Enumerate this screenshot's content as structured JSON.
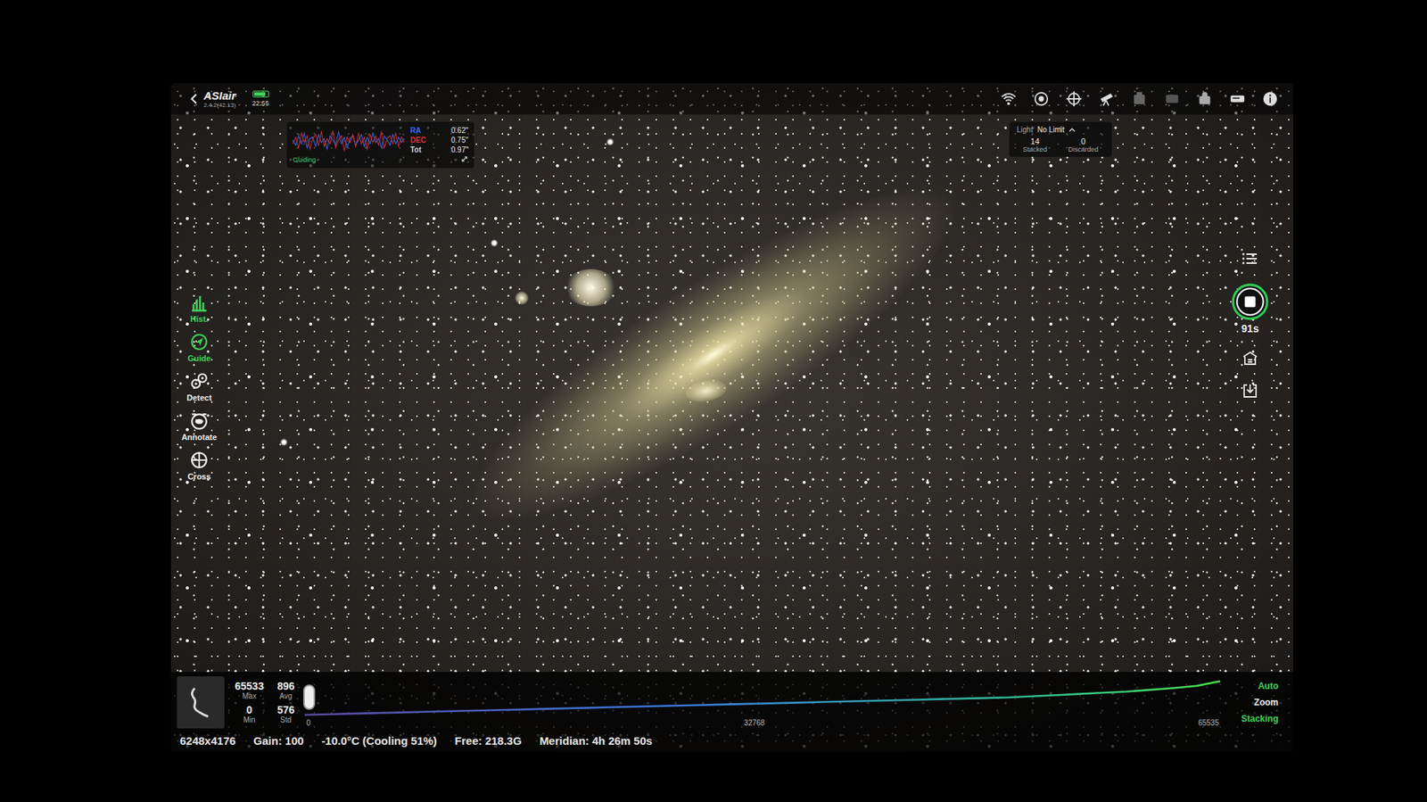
{
  "top_bar": {
    "app": "ASIair",
    "version": "2.4.2(42.13)",
    "time": "22:55",
    "battery_level": 0.85
  },
  "guiding": {
    "label": "Guiding",
    "readings": [
      {
        "name": "RA",
        "value": "0.62\"",
        "color": "#3a6cff"
      },
      {
        "name": "DEC",
        "value": "0.75\"",
        "color": "#e03030"
      },
      {
        "name": "Tot",
        "value": "0.97\"",
        "color": "#d8d8d8"
      }
    ],
    "ra_series": [
      0.1,
      -0.3,
      0.4,
      -0.2,
      0.6,
      -0.5,
      0.2,
      0.3,
      -0.4,
      0.5,
      -0.1,
      0.2,
      -0.6,
      0.4,
      0.1,
      -0.3,
      0.7,
      -0.2,
      0.3,
      -0.5,
      0.2,
      0.4,
      -0.3,
      0.1,
      0.5,
      -0.4,
      0.3,
      -0.2,
      0.6,
      -0.1,
      0.2,
      -0.5,
      0.4,
      0.1,
      -0.3,
      0.5,
      -0.2,
      0.3,
      -0.1,
      0.2
    ],
    "dec_series": [
      -0.2,
      0.3,
      -0.5,
      0.6,
      -0.1,
      0.4,
      -0.6,
      0.2,
      0.5,
      -0.3,
      0.7,
      -0.4,
      0.2,
      -0.2,
      0.8,
      -0.5,
      0.1,
      0.4,
      -0.7,
      0.3,
      -0.1,
      0.5,
      -0.4,
      0.6,
      -0.2,
      0.3,
      -0.6,
      0.5,
      -0.1,
      0.4,
      -0.3,
      0.7,
      -0.5,
      0.2,
      0.4,
      -0.2,
      0.6,
      -0.4,
      0.3,
      -0.1
    ]
  },
  "stack": {
    "mode": "Light",
    "limit": "No Limit",
    "stacked": "14",
    "stacked_label": "Stacked",
    "discarded": "0",
    "discarded_label": "Discarded"
  },
  "left_tools": [
    {
      "label": "Hist.",
      "kind": "hist",
      "active": true
    },
    {
      "label": "Guide",
      "kind": "guide",
      "active": true
    },
    {
      "label": "Detect",
      "kind": "detect",
      "active": false
    },
    {
      "label": "Annotate",
      "kind": "annotate",
      "active": false
    },
    {
      "label": "Cross",
      "kind": "cross",
      "active": false
    }
  ],
  "right_tools": {
    "countdown": "91s"
  },
  "histogram": {
    "stats": [
      {
        "value": "65533",
        "label": "Max"
      },
      {
        "value": "896",
        "label": "Avg"
      },
      {
        "value": "0",
        "label": "Min"
      },
      {
        "value": "576",
        "label": "Std"
      }
    ],
    "ticks": [
      "0",
      "32768",
      "65535"
    ],
    "values": [
      2,
      3,
      4,
      5,
      6,
      7,
      8,
      9,
      10,
      11,
      12,
      13,
      14,
      15,
      16,
      17,
      18,
      19,
      20,
      21,
      22,
      23,
      24,
      25,
      26,
      27,
      28,
      29,
      30,
      31,
      32,
      34,
      36,
      38,
      40,
      42,
      45,
      48,
      52,
      60
    ],
    "black_point": 0.0
  },
  "view_options": [
    {
      "label": "Auto",
      "active": true
    },
    {
      "label": "Zoom",
      "active": false
    },
    {
      "label": "Stacking",
      "active": true
    }
  ],
  "status_bar": [
    "6248x4176",
    "Gain: 100",
    "-10.0°C (Cooling 51%)",
    "Free: 218.3G",
    "Meridian: 4h 26m 50s"
  ]
}
